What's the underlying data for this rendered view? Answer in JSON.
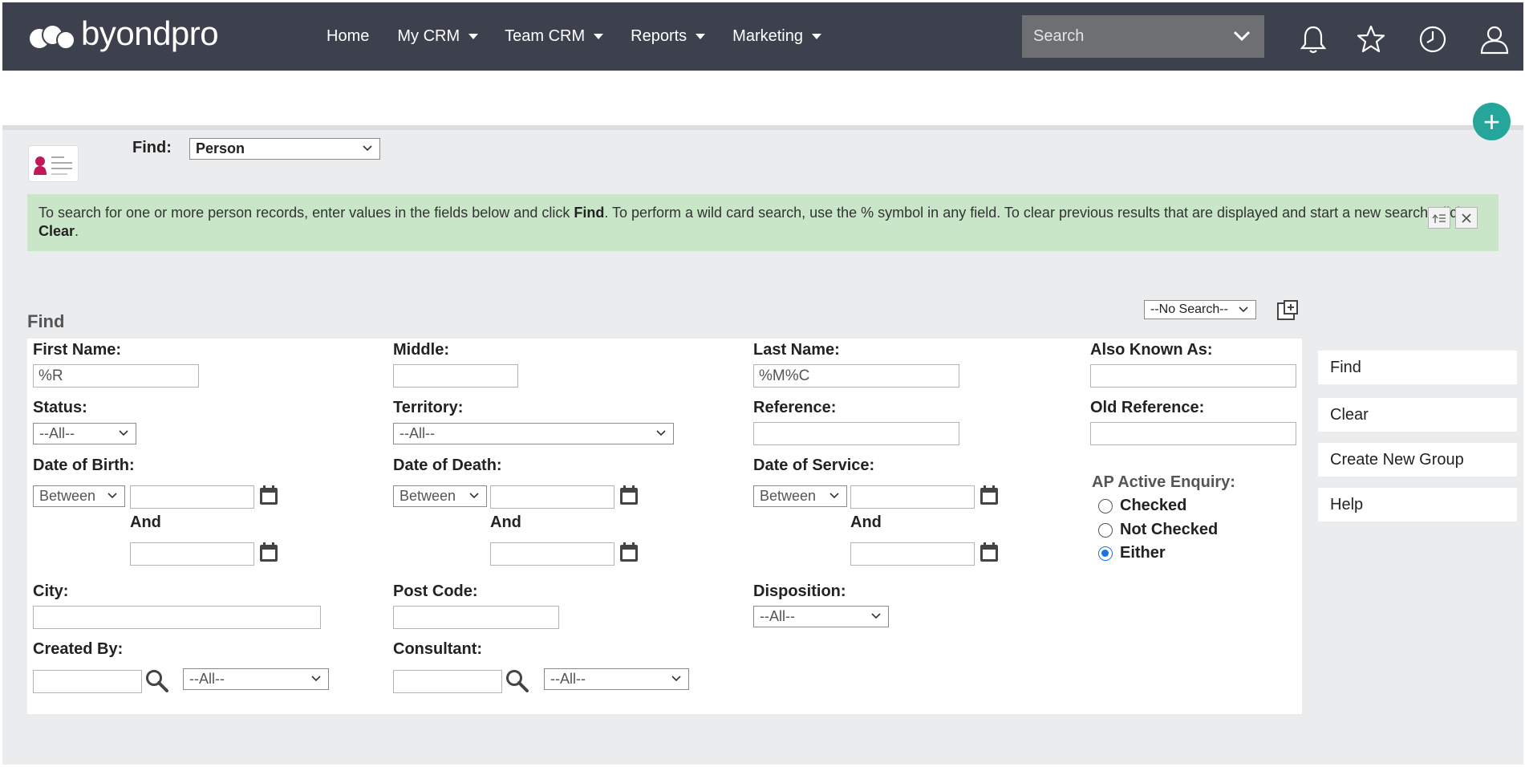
{
  "brand": {
    "logo_text": "byondpro"
  },
  "nav": {
    "items": [
      {
        "label": "Home",
        "has_menu": false
      },
      {
        "label": "My CRM",
        "has_menu": true
      },
      {
        "label": "Team CRM",
        "has_menu": true
      },
      {
        "label": "Reports",
        "has_menu": true
      },
      {
        "label": "Marketing",
        "has_menu": true
      }
    ],
    "search_placeholder": "Search",
    "icons": [
      "bell-icon",
      "star-icon",
      "clock-icon",
      "user-icon"
    ]
  },
  "find_bar": {
    "label": "Find:",
    "entity": "Person"
  },
  "info": {
    "text_1": "To search for one or more person records, enter values in the fields below and click ",
    "bold_1": "Find",
    "text_2": ". To perform a wild card search, use the % symbol in any field. To clear previous results that are displayed and start a new search, click ",
    "bold_2": "Clear",
    "text_3": "."
  },
  "saved_search": "--No Search--",
  "section_title": "Find",
  "form": {
    "first_name": {
      "label": "First Name:",
      "value": "%R"
    },
    "middle": {
      "label": "Middle:",
      "value": ""
    },
    "last_name": {
      "label": "Last Name:",
      "value": "%M%C"
    },
    "also_known_as": {
      "label": "Also Known As:",
      "value": ""
    },
    "status": {
      "label": "Status:",
      "value": "--All--"
    },
    "territory": {
      "label": "Territory:",
      "value": "--All--"
    },
    "reference": {
      "label": "Reference:",
      "value": ""
    },
    "old_reference": {
      "label": "Old Reference:",
      "value": ""
    },
    "date_of_birth": {
      "label": "Date of Birth:",
      "operator": "Between",
      "and_label": "And"
    },
    "date_of_death": {
      "label": "Date of Death:",
      "operator": "Between",
      "and_label": "And"
    },
    "date_of_service": {
      "label": "Date of Service:",
      "operator": "Between",
      "and_label": "And"
    },
    "ap_active_enquiry": {
      "label": "AP Active Enquiry:",
      "options": [
        "Checked",
        "Not Checked",
        "Either"
      ],
      "selected": "Either"
    },
    "city": {
      "label": "City:",
      "value": ""
    },
    "post_code": {
      "label": "Post Code:",
      "value": ""
    },
    "disposition": {
      "label": "Disposition:",
      "value": "--All--"
    },
    "created_by": {
      "label": "Created By:",
      "value": "",
      "filter": "--All--"
    },
    "consultant": {
      "label": "Consultant:",
      "value": "",
      "filter": "--All--"
    }
  },
  "actions": [
    "Find",
    "Clear",
    "Create New Group",
    "Help"
  ],
  "colors": {
    "nav_bg": "#3d414d",
    "accent": "#26a69a",
    "info_bg": "#c9e7c8",
    "page_bg": "#ebecee"
  }
}
